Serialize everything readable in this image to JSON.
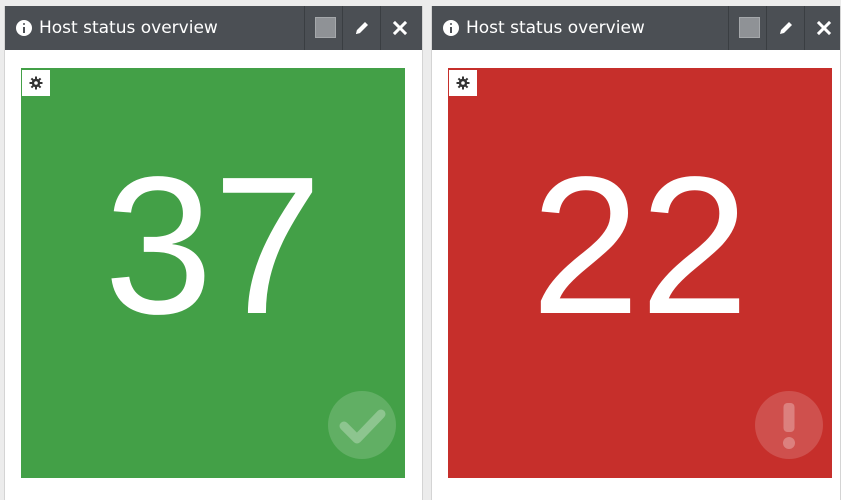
{
  "widgets": [
    {
      "title": "Host status overview",
      "value": "37",
      "tile_color": "#43a047",
      "status_icon": "check-circle-icon"
    },
    {
      "title": "Host status overview",
      "value": "22",
      "tile_color": "#c62f2b",
      "status_icon": "exclamation-circle-icon"
    }
  ],
  "colors": {
    "header_bg": "#4b4f54",
    "ok": "#43a047",
    "critical": "#c62f2b"
  },
  "icons": [
    "info-icon",
    "square-icon",
    "pencil-icon",
    "close-icon",
    "gear-icon"
  ]
}
